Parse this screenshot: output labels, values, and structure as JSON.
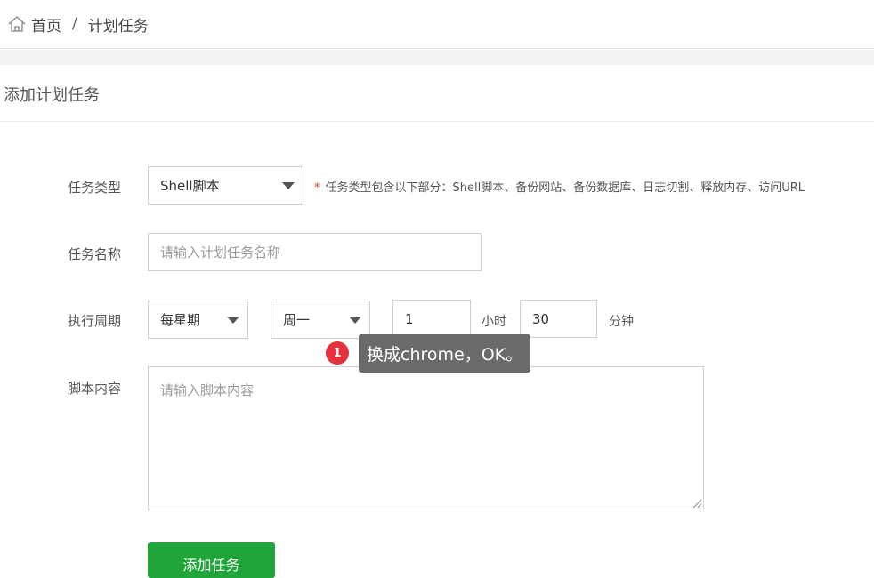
{
  "breadcrumb": {
    "home": "首页",
    "separator": "/",
    "current": "计划任务"
  },
  "section": {
    "title": "添加计划任务"
  },
  "form": {
    "task_type": {
      "label": "任务类型",
      "value": "Shell脚本",
      "hint_star": "*",
      "hint": "任务类型包含以下部分：Shell脚本、备份网站、备份数据库、日志切割、释放内存、访问URL"
    },
    "task_name": {
      "label": "任务名称",
      "placeholder": "请输入计划任务名称"
    },
    "cycle": {
      "label": "执行周期",
      "period": "每星期",
      "weekday": "周一",
      "hour": "1",
      "hour_unit": "小时",
      "minute": "30",
      "minute_unit": "分钟"
    },
    "script": {
      "label": "脚本内容",
      "placeholder": "请输入脚本内容"
    },
    "submit_label": "添加任务"
  },
  "annotation": {
    "badge": "1",
    "text": "换成chrome，OK。"
  },
  "colors": {
    "primary_button": "#20a53a",
    "badge": "#e5303d",
    "tooltip_bg": "#6a6a6a"
  }
}
